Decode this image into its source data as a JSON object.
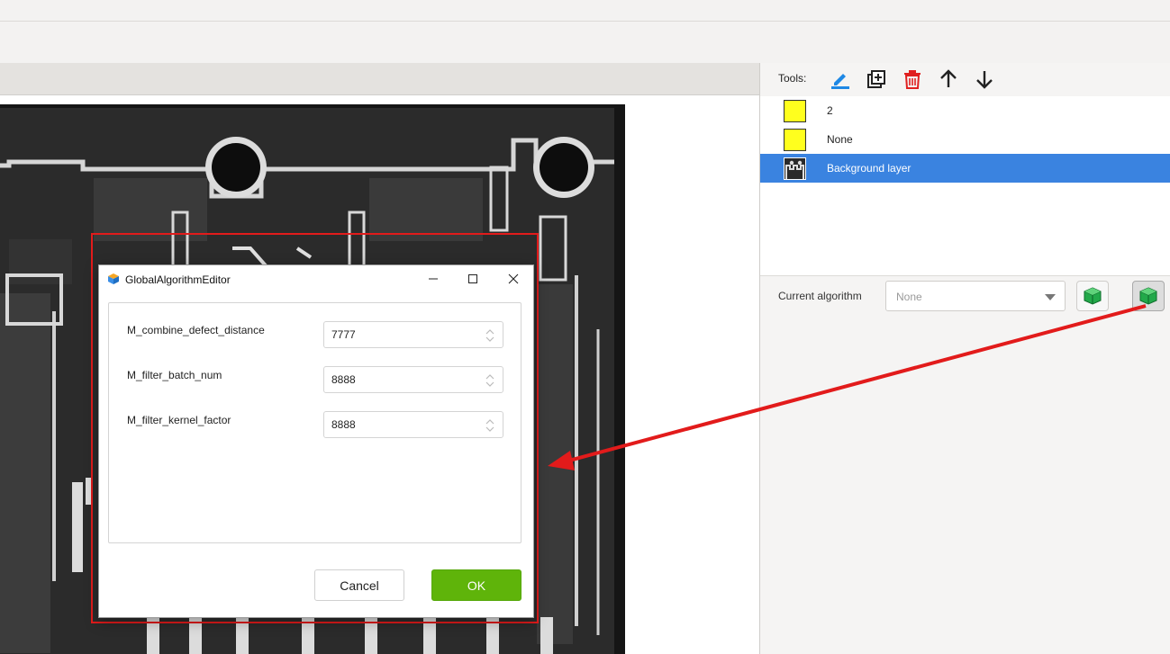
{
  "tools": {
    "label": "Tools:",
    "buttons": [
      "edit-pen-icon",
      "add-layer-icon",
      "delete-trash-icon",
      "move-up-arrow-icon",
      "move-down-arrow-icon"
    ]
  },
  "layers": [
    {
      "name": "2",
      "swatch": "#ffff1e",
      "selected": false
    },
    {
      "name": "None",
      "swatch": "#ffff1e",
      "selected": false
    },
    {
      "name": "Background layer",
      "swatch": "thumbnail",
      "selected": true
    }
  ],
  "algorithm": {
    "label": "Current algorithm",
    "selected": "None",
    "buttons": [
      "algorithm-cube-icon",
      "global-algorithm-cube-icon"
    ]
  },
  "dialog": {
    "title": "GlobalAlgorithmEditor",
    "params": [
      {
        "label": "M_combine_defect_distance",
        "value": "7777"
      },
      {
        "label": "M_filter_batch_num",
        "value": "8888"
      },
      {
        "label": "M_filter_kernel_factor",
        "value": "8888"
      }
    ],
    "cancel_label": "Cancel",
    "ok_label": "OK"
  },
  "colors": {
    "selection": "#3a83e0",
    "ok_button": "#5fb40a",
    "annotation": "#e21b1b",
    "cube_green": "#22a94a",
    "delete_red": "#e02020",
    "pen_blue": "#1e88e5"
  }
}
